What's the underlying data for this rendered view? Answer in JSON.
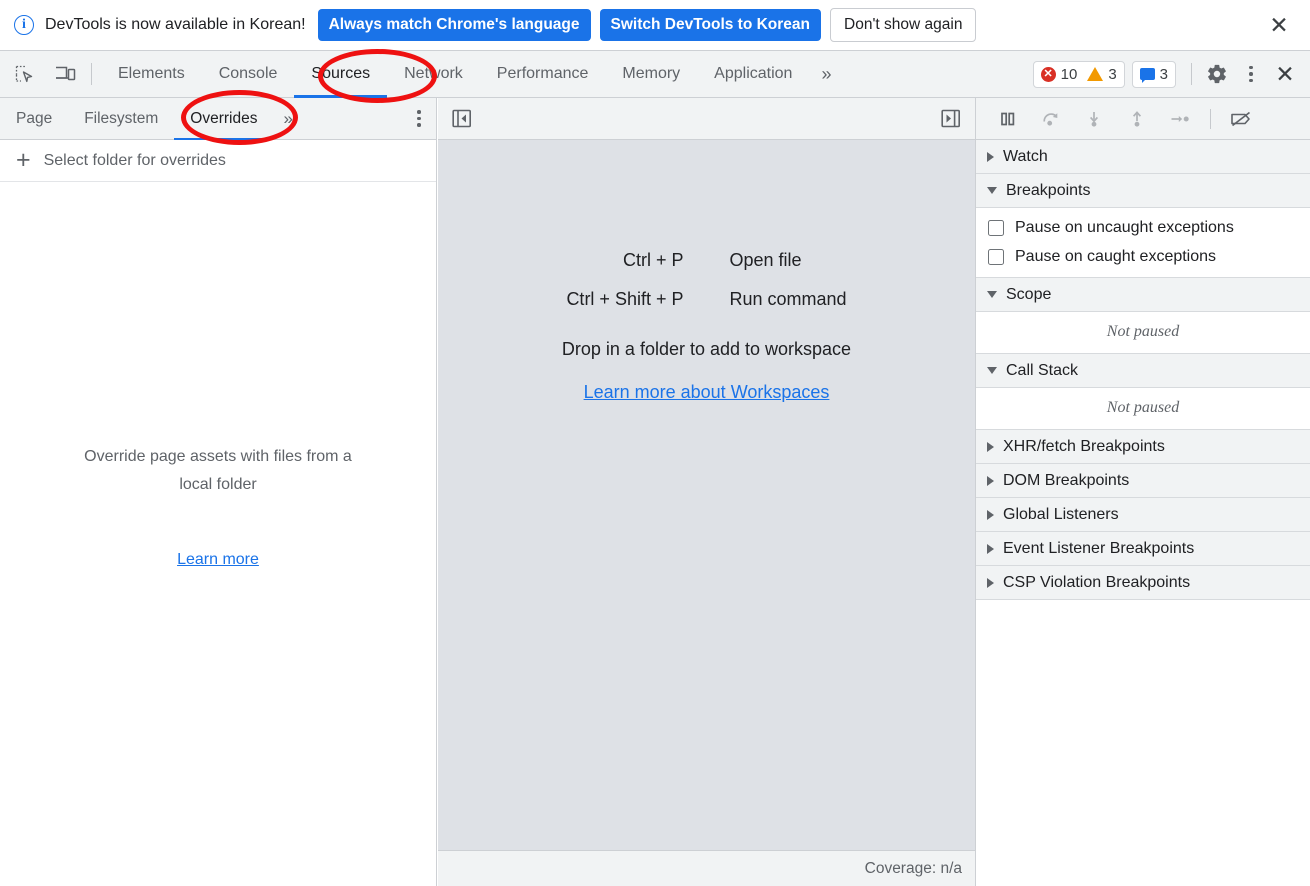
{
  "notification": {
    "icon": "info-circle-icon",
    "message": "DevTools is now available in Korean!",
    "primary_buttons": [
      "Always match Chrome's language",
      "Switch DevTools to Korean"
    ],
    "secondary_button": "Don't show again",
    "close_icon": "close-icon",
    "primary_color": "#1a73e8"
  },
  "toolbar": {
    "inspect_icon": "inspect-element-icon",
    "device_icon": "device-toolbar-icon",
    "tabs": [
      {
        "label": "Elements",
        "active": false
      },
      {
        "label": "Console",
        "active": false
      },
      {
        "label": "Sources",
        "active": true
      },
      {
        "label": "Network",
        "active": false
      },
      {
        "label": "Performance",
        "active": false
      },
      {
        "label": "Memory",
        "active": false
      },
      {
        "label": "Application",
        "active": false
      }
    ],
    "more_tabs_icon": "chevron-double-right-icon",
    "counters": {
      "errors": "10",
      "warnings": "3",
      "messages": "3",
      "error_color": "#d93025",
      "warning_color": "#f29900",
      "message_color": "#1a73e8"
    },
    "settings_icon": "gear-icon",
    "menu_icon": "kebab-menu-icon",
    "close_icon": "close-icon"
  },
  "navigator": {
    "tabs": [
      {
        "label": "Page",
        "active": false
      },
      {
        "label": "Filesystem",
        "active": false
      },
      {
        "label": "Overrides",
        "active": true
      }
    ],
    "more_icon": "chevron-double-right-icon",
    "menu_icon": "kebab-menu-icon",
    "select_folder": {
      "icon": "plus-icon",
      "label": "Select folder for overrides"
    },
    "empty_state": {
      "line1": "Override page assets with files from a",
      "line2": "local folder",
      "link": "Learn more"
    }
  },
  "editor": {
    "collapse_left_icon": "panel-collapse-left-icon",
    "collapse_right_icon": "panel-collapse-right-icon",
    "shortcuts": [
      {
        "key": "Ctrl + P",
        "description": "Open file"
      },
      {
        "key": "Ctrl + Shift + P",
        "description": "Run command"
      }
    ],
    "drop_hint": "Drop in a folder to add to workspace",
    "link": "Learn more about Workspaces",
    "status": "Coverage: n/a",
    "background": "#dee1e6"
  },
  "debugger": {
    "controls": [
      "pause-script-icon",
      "step-over-icon",
      "step-into-icon",
      "step-out-icon",
      "step-icon",
      "deactivate-breakpoints-icon"
    ],
    "sections": [
      {
        "title": "Watch",
        "expanded": false
      },
      {
        "title": "Breakpoints",
        "expanded": true
      },
      {
        "title": "Scope",
        "expanded": true
      },
      {
        "title": "Call Stack",
        "expanded": true
      },
      {
        "title": "XHR/fetch Breakpoints",
        "expanded": false
      },
      {
        "title": "DOM Breakpoints",
        "expanded": false
      },
      {
        "title": "Global Listeners",
        "expanded": false
      },
      {
        "title": "Event Listener Breakpoints",
        "expanded": false
      },
      {
        "title": "CSP Violation Breakpoints",
        "expanded": false
      }
    ],
    "breakpoint_options": [
      {
        "label": "Pause on uncaught exceptions",
        "checked": false
      },
      {
        "label": "Pause on caught exceptions",
        "checked": false
      }
    ],
    "scope_status": "Not paused",
    "callstack_status": "Not paused"
  },
  "annotations": {
    "color": "#ee1111",
    "highlights": [
      "Sources",
      "Overrides"
    ]
  }
}
